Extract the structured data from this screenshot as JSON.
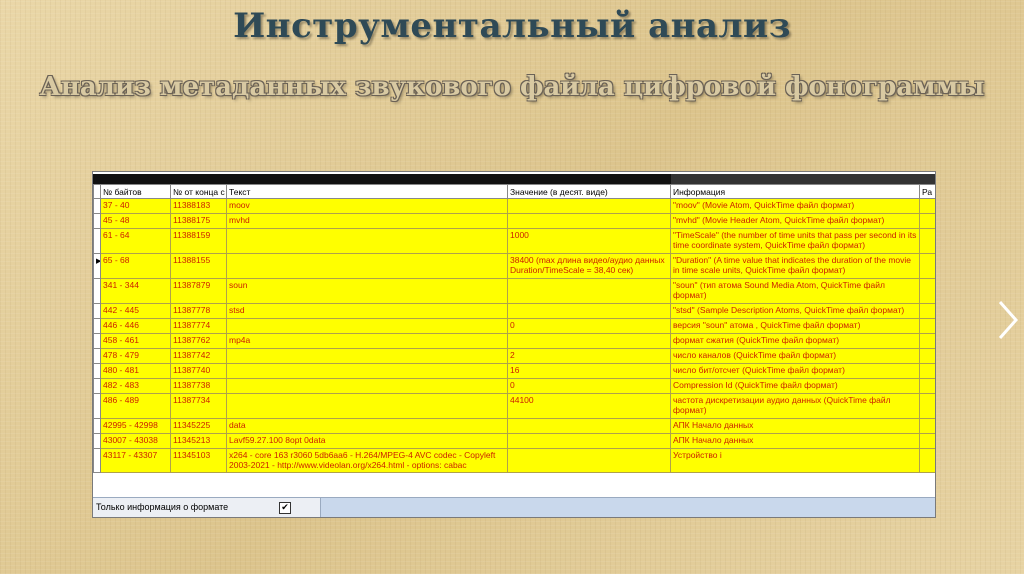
{
  "slide": {
    "title": "Инструментальный анализ",
    "subtitle": "Анализ метаданных звукового файла цифровой фонограммы"
  },
  "table": {
    "columns": [
      "№ байтов",
      "№ от конца с",
      "Текст",
      "Значение (в десят. виде)",
      "Информация",
      "Ра"
    ],
    "rows": [
      {
        "bytes": "37 - 40",
        "from_end": "11388183",
        "text": "moov",
        "value": "",
        "info": "\"moov\" (Movie Atom, QuickTime файл формат)"
      },
      {
        "bytes": "45 - 48",
        "from_end": "11388175",
        "text": "mvhd",
        "value": "",
        "info": "\"mvhd\" (Movie Header Atom, QuickTime файл формат)"
      },
      {
        "bytes": "61 - 64",
        "from_end": "11388159",
        "text": "",
        "value": "1000",
        "info": "\"TimeScale\" (the number of time units that pass per second in its time coordinate system, QuickTime файл формат)"
      },
      {
        "bytes": "65 - 68",
        "from_end": "11388155",
        "text": "",
        "value": "38400 (max длина видео/аудио данных Duration/TimeScale = 38,40 сек)",
        "info": "\"Duration\" (A time value that indicates the duration of the movie in time scale units, QuickTime файл формат)"
      },
      {
        "bytes": "341 - 344",
        "from_end": "11387879",
        "text": "soun",
        "value": "",
        "info": "\"soun\" (тип атома Sound Media Atom, QuickTime файл формат)"
      },
      {
        "bytes": "442 - 445",
        "from_end": "11387778",
        "text": "stsd",
        "value": "",
        "info": "\"stsd\" (Sample Description Atoms, QuickTime файл формат)"
      },
      {
        "bytes": "446 - 446",
        "from_end": "11387774",
        "text": "",
        "value": "0",
        "info": "версия \"soun\" атома , QuickTime файл формат)"
      },
      {
        "bytes": "458 - 461",
        "from_end": "11387762",
        "text": "mp4a",
        "value": "",
        "info": "формат сжатия (QuickTime файл формат)"
      },
      {
        "bytes": "478 - 479",
        "from_end": "11387742",
        "text": "",
        "value": "2",
        "info": "число каналов (QuickTime файл формат)"
      },
      {
        "bytes": "480 - 481",
        "from_end": "11387740",
        "text": "",
        "value": "16",
        "info": "число бит/отсчет (QuickTime файл формат)"
      },
      {
        "bytes": "482 - 483",
        "from_end": "11387738",
        "text": "",
        "value": "0",
        "info": "Compression Id (QuickTime файл формат)"
      },
      {
        "bytes": "486 - 489",
        "from_end": "11387734",
        "text": "",
        "value": "44100",
        "info": "частота дискретизации аудио данных (QuickTime файл формат)"
      },
      {
        "bytes": "42995 - 42998",
        "from_end": "11345225",
        "text": "data",
        "value": "",
        "info": "АПК Начало данных"
      },
      {
        "bytes": "43007 - 43038",
        "from_end": "11345213",
        "text": "Lavf59.27.100 8opt 0data",
        "value": "",
        "info": "АПК Начало данных"
      },
      {
        "bytes": "43117 - 43307",
        "from_end": "11345103",
        "text": "x264 - core 163 r3060 5db6aa6 - H.264/MPEG-4 AVC codec - Copyleft 2003-2021 - http://www.videolan.org/x264.html - options: cabac",
        "value": "",
        "info": "Устройство i"
      }
    ]
  },
  "status": {
    "checkbox_label": "Только информация о формате",
    "checkbox_mark": "✔"
  }
}
